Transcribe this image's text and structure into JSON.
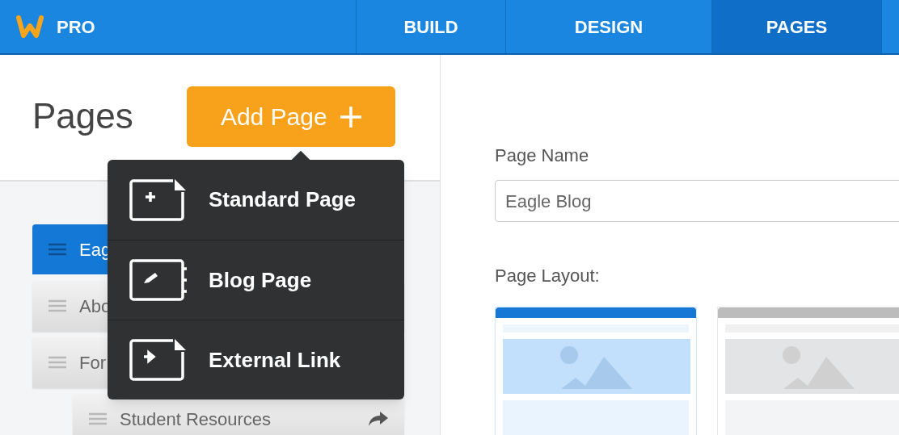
{
  "brand": {
    "label": "PRO"
  },
  "nav": [
    {
      "label": "BUILD",
      "selected": false
    },
    {
      "label": "DESIGN",
      "selected": false
    },
    {
      "label": "PAGES",
      "selected": true
    }
  ],
  "sidebar": {
    "title": "Pages",
    "add_button": "Add Page",
    "items": [
      {
        "label": "Eag",
        "selected": true
      },
      {
        "label": "Abo",
        "selected": false
      },
      {
        "label": "For",
        "selected": false,
        "children": [
          {
            "label": "Student Resources",
            "selected": false,
            "external": true
          }
        ]
      }
    ]
  },
  "add_menu": [
    {
      "kind": "standard",
      "label": "Standard Page"
    },
    {
      "kind": "blog",
      "label": "Blog Page"
    },
    {
      "kind": "external",
      "label": "External Link"
    }
  ],
  "settings": {
    "name_label": "Page Name",
    "name_value": "Eagle Blog",
    "layout_label": "Page Layout:",
    "layouts": [
      {
        "selected": true
      },
      {
        "selected": false
      }
    ]
  }
}
